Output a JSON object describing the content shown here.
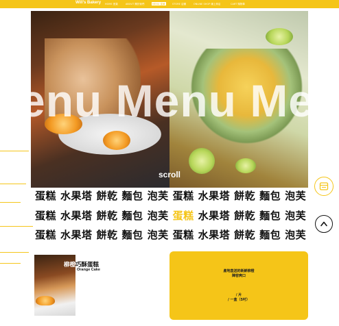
{
  "nav": {
    "brand": "Will's Bakery",
    "items": [
      {
        "label": "HOME 首頁",
        "active": false
      },
      {
        "label": "ABOUT 關於我們",
        "active": false
      },
      {
        "label": "MENU 菜單",
        "active": true
      },
      {
        "label": "STORE 店鋪",
        "active": false
      },
      {
        "label": "ONLINE SHOP 線上商店",
        "active": false
      },
      {
        "label": "CART 購物車",
        "active": false
      }
    ]
  },
  "hero": {
    "overlay_text": "enu Menu Menu Men",
    "scroll_label": "scroll"
  },
  "marquee": {
    "rows": [
      [
        "蛋糕",
        "水果塔",
        "餅乾",
        "麵包",
        "泡芙",
        "蛋糕",
        "水果塔",
        "餅乾",
        "麵包",
        "泡芙"
      ],
      [
        "蛋糕",
        "水果塔",
        "餅乾",
        "麵包",
        "泡芙",
        "蛋糕",
        "水果塔",
        "餅乾",
        "麵包",
        "泡芙"
      ],
      [
        "蛋糕",
        "水果塔",
        "餅乾",
        "麵包",
        "泡芙",
        "蛋糕",
        "水果塔",
        "餅乾",
        "麵包",
        "泡芙"
      ]
    ],
    "highlight": {
      "row": 1,
      "index": 5
    },
    "highlight_color": "#f5c518"
  },
  "product": {
    "title_highlight": "柳橙",
    "title_rest": "巧酥蛋糕",
    "subtitle": "Orange Cake",
    "info_lines": [
      "產地直送的新鮮柳橙",
      "陣容爽口",
      "",
      "/ 片",
      "/ 一盒（5吋）"
    ]
  },
  "icons": {
    "cart": "cart-icon",
    "back_to_top": "chevron-up-icon"
  },
  "colors": {
    "accent": "#f5c518",
    "text": "#111111"
  }
}
